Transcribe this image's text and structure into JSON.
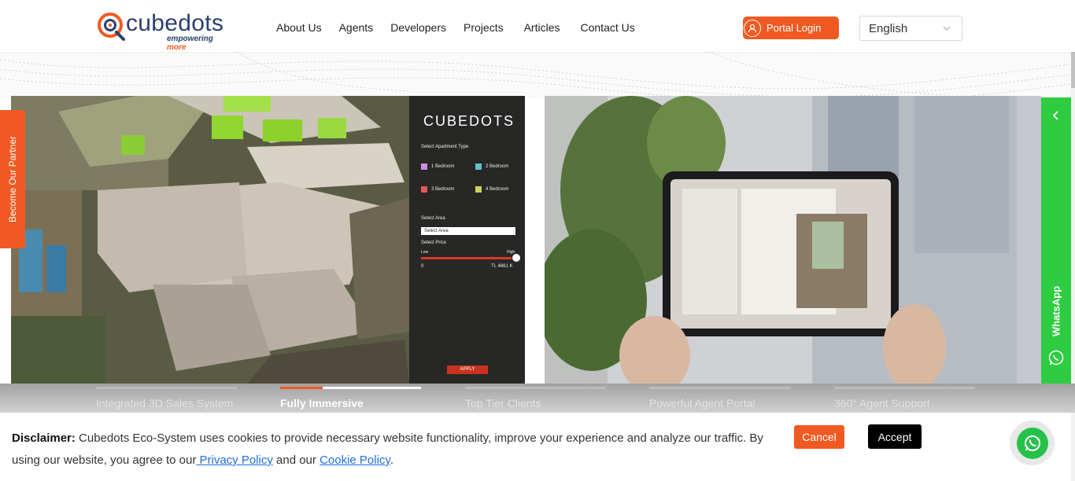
{
  "header": {
    "logo_text": "cubedots",
    "logo_tag_a": "empowering ",
    "logo_tag_b": "more",
    "nav": [
      "About Us",
      "Agents",
      "Developers",
      "Projects",
      "Articles",
      "Contact Us"
    ],
    "portal_label": "Portal Login",
    "language": "English"
  },
  "left_panel": {
    "brand": "CUBEDOTS",
    "apartment_type_label": "Select Apartment Type",
    "options": [
      "1 Bedroom",
      "2 Bedroom",
      "3 Bedroom",
      "4 Bedroom"
    ],
    "area_label": "Select Area",
    "area_select": "Select Area",
    "price_label": "Select Price",
    "price_low": "Low",
    "price_high": "High",
    "price_min": "0",
    "price_max": "TL 4861 K",
    "apply": "APPLY"
  },
  "side": {
    "partner": "Become Our Partner",
    "whatsapp": "WhatsApp"
  },
  "features": [
    {
      "label": "Integrated 3D Sales System",
      "progress": 0
    },
    {
      "label": "Fully Immersive",
      "progress": 0.3
    },
    {
      "label": "Top Tier Clients",
      "progress": 0
    },
    {
      "label": "Powerful Agent Portal",
      "progress": 0
    },
    {
      "label": "360° Agent Support",
      "progress": 0
    }
  ],
  "cookie": {
    "title": "Disclaimer:",
    "text_a": " Cubedots Eco-System uses cookies to provide necessary website functionality, improve your experience and analyze our traffic. By using our website, you agree to our",
    "privacy": " Privacy Policy",
    "text_b": " and our ",
    "cookie_policy": "Cookie Policy",
    "text_c": ".",
    "cancel": "Cancel",
    "accept": "Accept"
  },
  "colors": {
    "accent": "#f05a22",
    "brand_blue": "#2a3e6e",
    "whatsapp": "#2ecc40"
  }
}
